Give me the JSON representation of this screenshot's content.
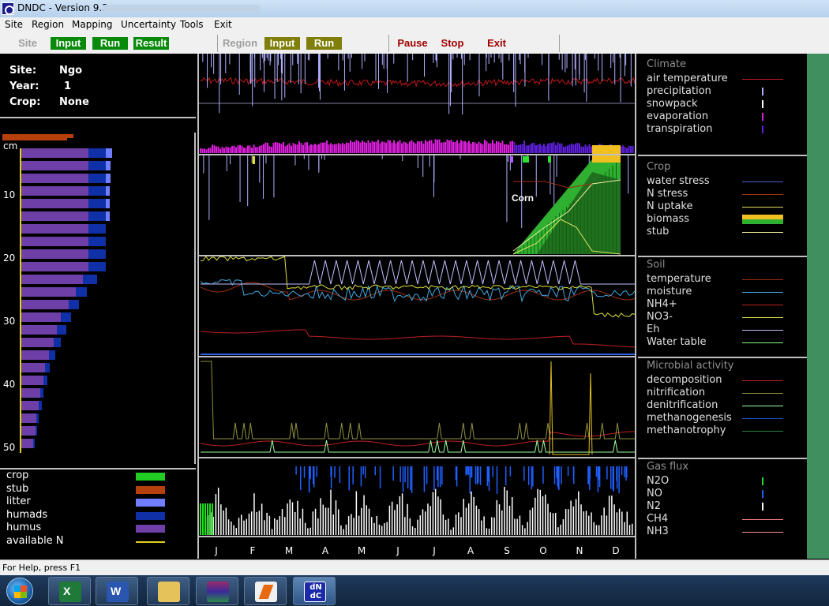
{
  "window": {
    "title": "DNDC - Version 9.3"
  },
  "menu": [
    "Site",
    "Region",
    "Mapping",
    "Uncertainty",
    "Tools",
    "Exit"
  ],
  "toolbar": {
    "site": "Site",
    "site_input": "Input",
    "site_run": "Run",
    "site_result": "Result",
    "region": "Region",
    "region_input": "Input",
    "region_run": "Run",
    "pause": "Pause",
    "stop": "Stop",
    "exit": "Exit"
  },
  "site": {
    "site_label": "Site:",
    "site_value": "Ngo",
    "year_label": "Year:",
    "year_value": "1",
    "crop_label": "Crop:",
    "crop_value": "None"
  },
  "depth_axis": {
    "unit": "cm",
    "ticks": [
      "10",
      "20",
      "30",
      "40",
      "50"
    ]
  },
  "soil_legend": [
    {
      "label": "crop",
      "color": "#22cc22"
    },
    {
      "label": "stub",
      "color": "#b5400e"
    },
    {
      "label": "litter",
      "color": "#6f7fff"
    },
    {
      "label": "humads",
      "color": "#1030a8"
    },
    {
      "label": "humus",
      "color": "#6f3fa8"
    },
    {
      "label": "available N",
      "color": "#e0d020"
    }
  ],
  "months": [
    "J",
    "F",
    "M",
    "A",
    "M",
    "J",
    "J",
    "A",
    "S",
    "O",
    "N",
    "D"
  ],
  "crop_annotation": "Corn",
  "panels": [
    {
      "title": "Climate",
      "items": [
        {
          "label": "air temperature",
          "color": "#c01818",
          "marker": "line"
        },
        {
          "label": "precipitation",
          "color": "#b0b0ff",
          "marker": "bar"
        },
        {
          "label": "snowpack",
          "color": "#ffffff",
          "marker": "bar"
        },
        {
          "label": "evaporation",
          "color": "#e020e0",
          "marker": "bar"
        },
        {
          "label": "transpiration",
          "color": "#6020e0",
          "marker": "bar"
        }
      ]
    },
    {
      "title": "Crop",
      "items": [
        {
          "label": "water stress",
          "color": "#5060d0",
          "marker": "line"
        },
        {
          "label": "N stress",
          "color": "#a03010",
          "marker": "line"
        },
        {
          "label": "N uptake",
          "color": "#e0e060",
          "marker": "line"
        },
        {
          "label": "biomass",
          "color": "#f0c020",
          "marker": "biomass"
        },
        {
          "label": "stub",
          "color": "#f0f0a0",
          "marker": "line"
        }
      ]
    },
    {
      "title": "Soil",
      "items": [
        {
          "label": "temperature",
          "color": "#a03010",
          "marker": "line"
        },
        {
          "label": "moisture",
          "color": "#40a8e0",
          "marker": "line"
        },
        {
          "label": "NH4+",
          "color": "#c02020",
          "marker": "line"
        },
        {
          "label": "NO3-",
          "color": "#e0e040",
          "marker": "line"
        },
        {
          "label": "Eh",
          "color": "#c0c0ff",
          "marker": "line"
        },
        {
          "label": "Water table",
          "color": "#80ff80",
          "marker": "line"
        }
      ]
    },
    {
      "title": "Microbial activity",
      "items": [
        {
          "label": "decomposition",
          "color": "#c02020",
          "marker": "line"
        },
        {
          "label": "nitrification",
          "color": "#909040",
          "marker": "line"
        },
        {
          "label": "denitrification",
          "color": "#a0ffa0",
          "marker": "line"
        },
        {
          "label": "methanogenesis",
          "color": "#2050d0",
          "marker": "line"
        },
        {
          "label": "methanotrophy",
          "color": "#208040",
          "marker": "line"
        }
      ]
    },
    {
      "title": "Gas flux",
      "items": [
        {
          "label": "N2O",
          "color": "#20e020",
          "marker": "bar"
        },
        {
          "label": "NO",
          "color": "#2060ff",
          "marker": "bar"
        },
        {
          "label": "N2",
          "color": "#ffffff",
          "marker": "bar"
        },
        {
          "label": "CH4",
          "color": "#ff8080",
          "marker": "line"
        },
        {
          "label": "NH3",
          "color": "#ff9090",
          "marker": "line"
        }
      ]
    }
  ],
  "status": "For Help, press F1",
  "taskbar": [
    "start-button",
    "excel",
    "word",
    "file-explorer",
    "winrar",
    "app-launcher",
    "dndc"
  ],
  "taskbar_dndc_text": "dN dC"
}
